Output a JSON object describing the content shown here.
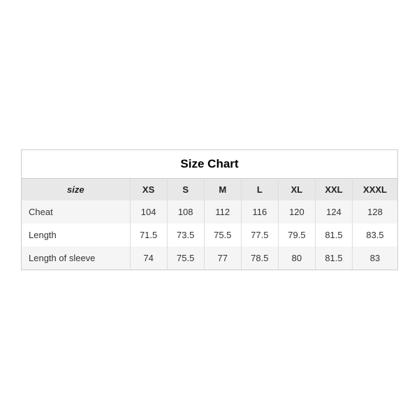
{
  "table": {
    "title": "Size Chart",
    "headers": [
      "size",
      "XS",
      "S",
      "M",
      "L",
      "XL",
      "XXL",
      "XXXL"
    ],
    "rows": [
      {
        "label": "Cheat",
        "values": [
          "104",
          "108",
          "112",
          "116",
          "120",
          "124",
          "128"
        ]
      },
      {
        "label": "Length",
        "values": [
          "71.5",
          "73.5",
          "75.5",
          "77.5",
          "79.5",
          "81.5",
          "83.5"
        ]
      },
      {
        "label": "Length of sleeve",
        "values": [
          "74",
          "75.5",
          "77",
          "78.5",
          "80",
          "81.5",
          "83"
        ]
      }
    ]
  }
}
